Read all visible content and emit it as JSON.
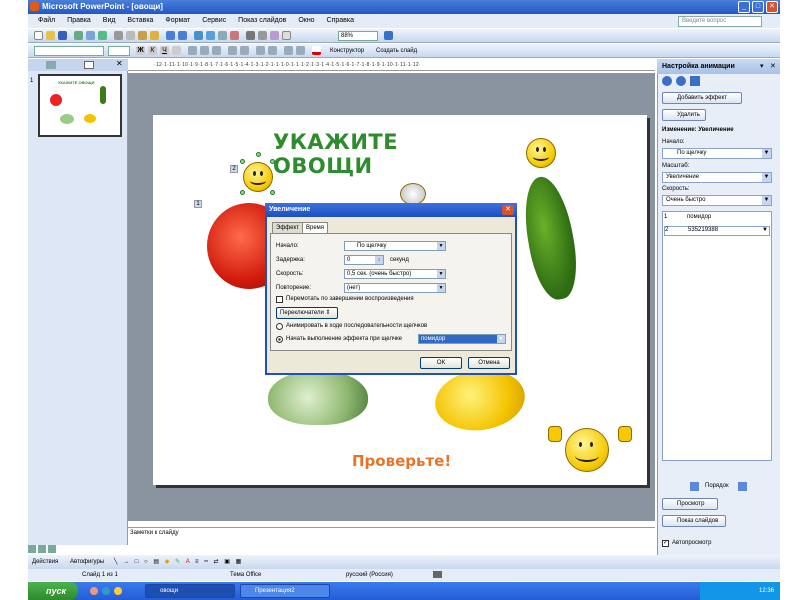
{
  "window": {
    "title": "Microsoft PowerPoint - [овощи]"
  },
  "menu": {
    "items": [
      "Файл",
      "Правка",
      "Вид",
      "Вставка",
      "Формат",
      "Сервис",
      "Показ слайдов",
      "Окно",
      "Справка"
    ],
    "help_placeholder": "Введите вопрос"
  },
  "toolbar": {
    "zoom": "88%",
    "constructor_label": "Конструктор",
    "new_slide_label": "Создать слайд"
  },
  "ruler": {
    "h_text": "·12·1·11·1·10·1·9·1·8·1·7·1·6·1·5·1·4·1·3·1·2·1·1·1·0·1·1·1·2·1·3·1·4·1·5·1·6·1·7·1·8·1·9·1·10·1·11·1·12·"
  },
  "slides_panel": {
    "slide_number": "1",
    "thumb_title": "УКАЖИТЕ ОВОЩИ"
  },
  "slide": {
    "title": "УКАЖИТЕ ОВОЩИ",
    "check_text": "Проверьте!",
    "marker_1": "1",
    "marker_2": "2"
  },
  "dialog": {
    "title": "Увеличение",
    "tabs": [
      "Эффект",
      "Время"
    ],
    "start_label": "Начало:",
    "start_value": "По щелчку",
    "delay_label": "Задержка:",
    "delay_value": "0",
    "delay_unit": "секунд",
    "speed_label": "Скорость:",
    "speed_value": "0,5 сек. (очень быстро)",
    "repeat_label": "Повторение:",
    "repeat_value": "(нет)",
    "rewind_label": "Перемотать по завершении воспроизведения",
    "triggers_label": "Переключатели",
    "animate_seq_label": "Анимировать в ходе последовательности щелчков",
    "start_on_click_label": "Начать выполнение эффекта при щелчке",
    "trigger_value": "помидор",
    "ok": "ОК",
    "cancel": "Отмена"
  },
  "animation_panel": {
    "title": "Настройка анимации",
    "add_effect": "Добавить эффект",
    "remove": "Удалить",
    "change_label": "Изменение: Увеличение",
    "start_label": "Начало:",
    "start_value": "По щелчку",
    "scale_label": "Масштаб:",
    "scale_value": "Увеличение",
    "speed_label": "Скорость:",
    "speed_value": "Очень быстро",
    "list": [
      {
        "num": "1",
        "name": "помидор"
      },
      {
        "num": "2",
        "name": "535219388"
      }
    ],
    "order_label": "Порядок",
    "preview": "Просмотр",
    "slideshow": "Показ слайдов",
    "autopreview": "Автопросмотр"
  },
  "notes": {
    "placeholder": "Заметки к слайду"
  },
  "drawbar": {
    "actions": "Действия",
    "autoshapes": "Автофигуры"
  },
  "status": {
    "slide": "Слайд 1 из 1",
    "theme": "Тема Office",
    "language": "русский (Россия)"
  },
  "taskbar": {
    "start": "пуск",
    "tasks": [
      "овощи",
      "Презентация2"
    ],
    "clock": "12:36"
  },
  "colors": {
    "title_green": "#2e8b2e",
    "check_orange": "#e8742a",
    "xp_blue": "#245dd6"
  }
}
